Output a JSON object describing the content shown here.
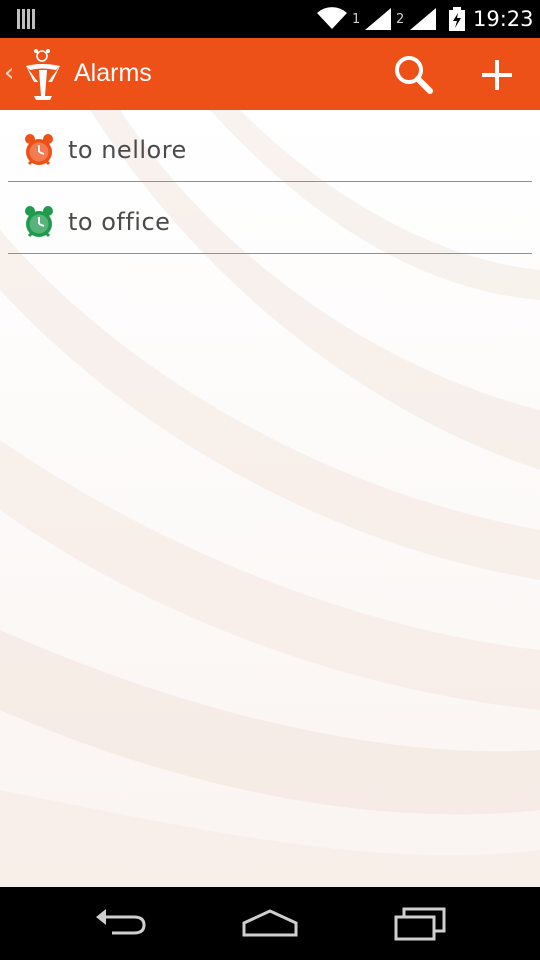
{
  "status_bar": {
    "time": "19:23",
    "sim1": "1",
    "sim2": "2",
    "icons": [
      "notification-icon",
      "wifi-icon",
      "signal-icon",
      "signal-icon",
      "battery-charging-icon"
    ]
  },
  "action_bar": {
    "title": "Alarms",
    "background_color": "#EE5117",
    "icons": [
      "back-chevron-icon",
      "app-logo-icon",
      "search-icon",
      "add-icon"
    ]
  },
  "alarms": [
    {
      "label": "to nellore",
      "icon": "alarm-clock-icon",
      "color": "#EE5117"
    },
    {
      "label": "to office",
      "icon": "alarm-clock-icon",
      "color": "#1F9A4E"
    }
  ],
  "nav_bar": {
    "icons": [
      "back-icon",
      "home-icon",
      "recents-icon"
    ]
  }
}
